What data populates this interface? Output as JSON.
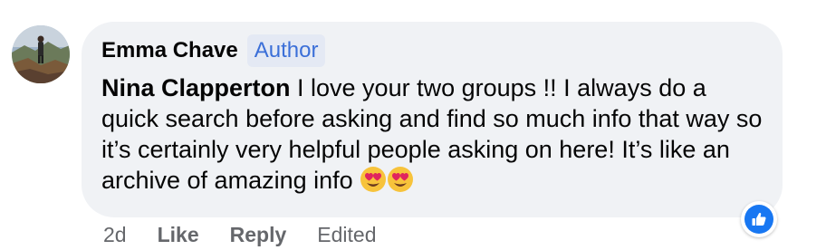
{
  "comment": {
    "author": "Emma Chave",
    "badge": "Author",
    "mention": "Nina Clapperton",
    "text": " I love your two groups !! I always do a quick search before asking and find so much info that way so it’s certainly very helpful people asking on here! It’s like an archive of amazing info ",
    "emojis": [
      "heart-eyes-emoji",
      "heart-eyes-emoji"
    ]
  },
  "reaction": {
    "icon": "thumbs-up-icon",
    "color": "#1877f2"
  },
  "actions": {
    "time": "2d",
    "like": "Like",
    "reply": "Reply",
    "edited": "Edited"
  },
  "colors": {
    "bubble": "#f0f2f5",
    "text": "#050505",
    "meta": "#65676b",
    "badge_text": "#3b6fd8"
  }
}
